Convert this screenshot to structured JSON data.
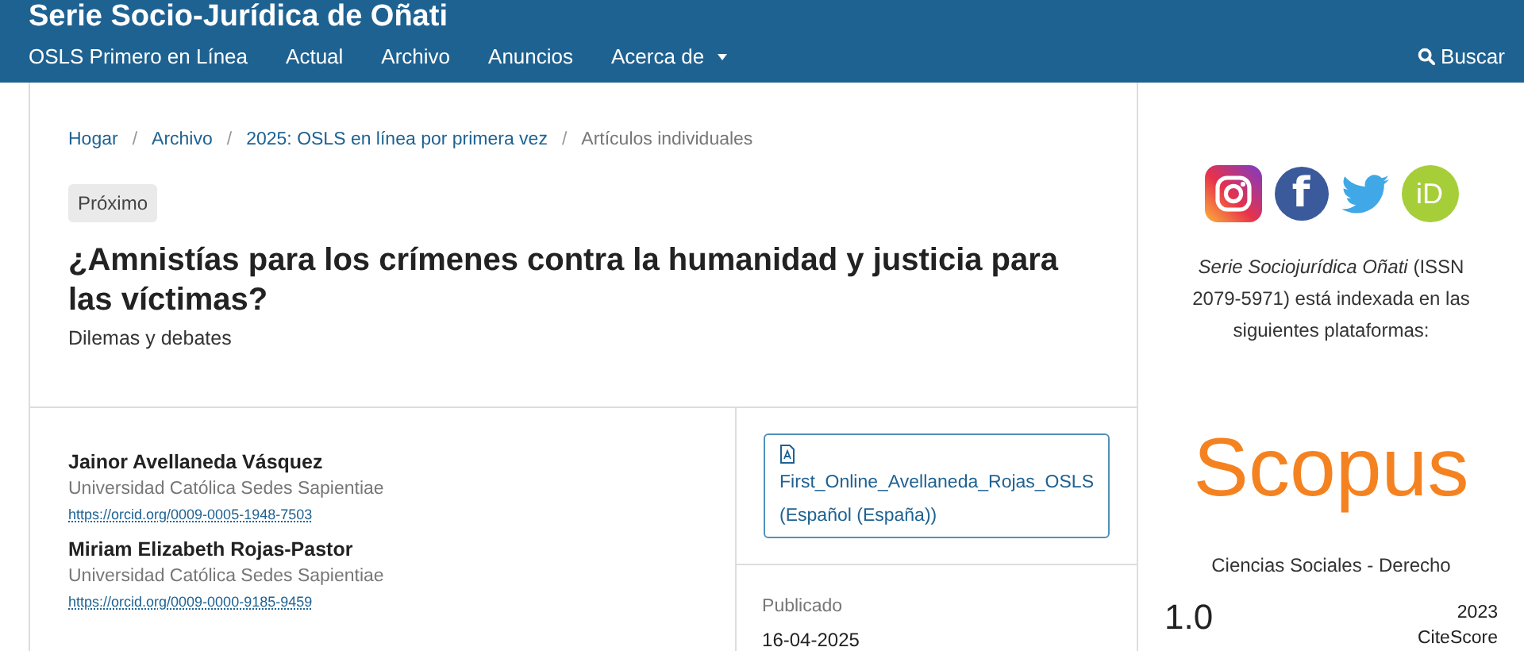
{
  "header": {
    "title": "Serie Socio-Jurídica de Oñati",
    "nav": [
      {
        "label": "OSLS Primero en Línea",
        "dropdown": false
      },
      {
        "label": "Actual",
        "dropdown": false
      },
      {
        "label": "Archivo",
        "dropdown": false
      },
      {
        "label": "Anuncios",
        "dropdown": false
      },
      {
        "label": "Acerca de",
        "dropdown": true
      }
    ],
    "search": "Buscar"
  },
  "breadcrumbs": [
    {
      "label": "Hogar",
      "link": true
    },
    {
      "separator": "/",
      "label": "Archivo",
      "link": true
    },
    {
      "separator": "/",
      "label": "2025: OSLS en línea por primera vez",
      "link": true
    },
    {
      "separator": "/",
      "label": "Artículos individuales",
      "link": false
    }
  ],
  "article": {
    "badge": "Próximo",
    "title": "¿Amnistías para los crímenes contra la humanidad y justicia para las víctimas?",
    "subtitle": "Dilemas y debates",
    "authors": [
      {
        "name": "Jainor Avellaneda Vásquez",
        "affiliation": "Universidad Católica Sedes Sapientiae",
        "orcid": "https://orcid.org/0009-0005-1948-7503"
      },
      {
        "name": "Miriam Elizabeth Rojas-Pastor",
        "affiliation": "Universidad Católica Sedes Sapientiae",
        "orcid": "https://orcid.org/0009-0000-9185-9459"
      }
    ],
    "galley": {
      "file": "First_Online_Avellaneda_Rojas_OSLS",
      "language": "(Español (España))"
    },
    "published": {
      "label": "Publicado",
      "date": "16-04-2025"
    }
  },
  "sidebar": {
    "social": [
      {
        "kind": "instagram"
      },
      {
        "kind": "facebook",
        "glyph": "f"
      },
      {
        "kind": "twitter"
      },
      {
        "kind": "orcid",
        "glyph": "iD"
      }
    ],
    "indexing": "*Serie Sociojurídica Oñati* (ISSN 2079-5971) está indexada en las siguientes plataformas:",
    "logo": "Scopus",
    "category": "Ciencias Sociales - Derecho",
    "score": "1.0",
    "year": "2023",
    "score_label": "CiteScore"
  }
}
